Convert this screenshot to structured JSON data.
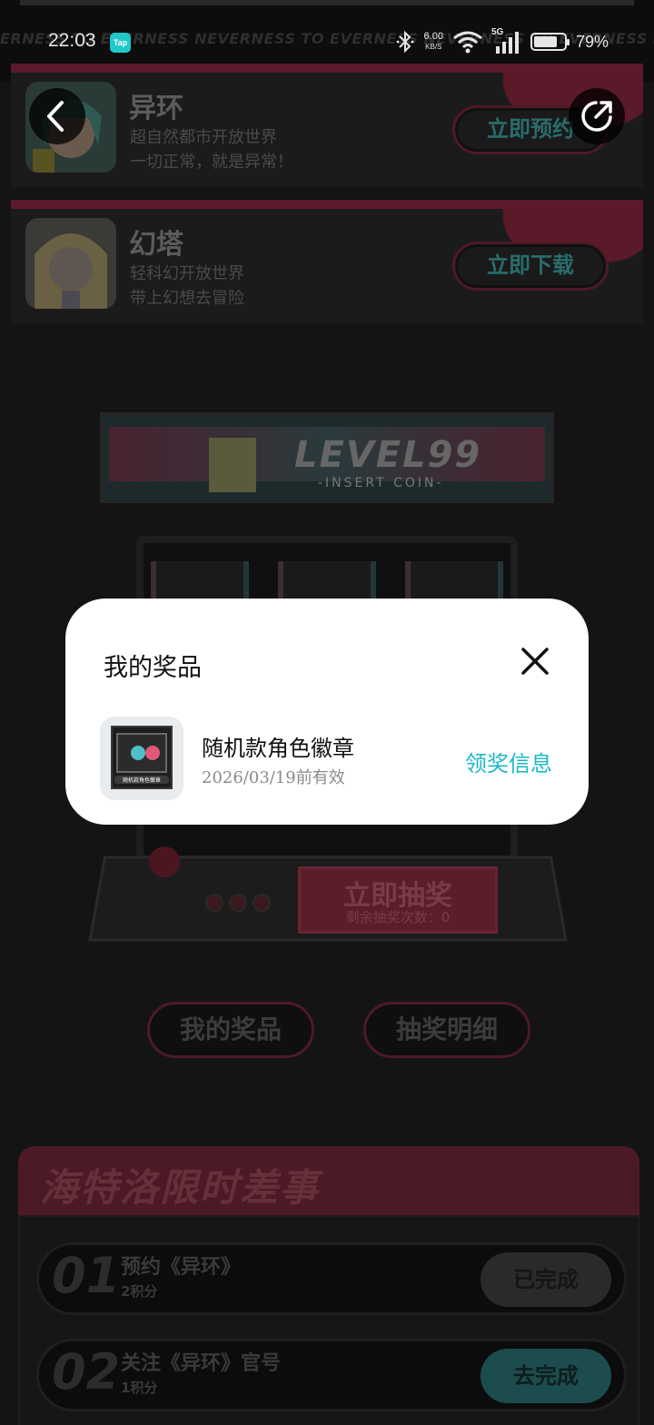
{
  "status_bar": {
    "time": "22:03",
    "app_badge": "Tap",
    "marquee_text": "ERNESS TO EVERNESS   NEVERNESS TO EVERNESS   NEVERNESS TO EVERNESS   NEVERNESS TO EVERNESS",
    "net_speed": "6.00",
    "net_unit": "KB/S",
    "network_type": "5G",
    "battery_percent": "79%",
    "battery_level": 0.79
  },
  "games": [
    {
      "title": "异环",
      "desc_line1": "超自然都市开放世界",
      "desc_line2": "一切正常，就是异常！",
      "cta": "立即预约"
    },
    {
      "title": "幻塔",
      "desc_line1": "轻科幻开放世界",
      "desc_line2": "带上幻想去冒险",
      "cta": "立即下载"
    }
  ],
  "arcade": {
    "marquee_title": "LEVEL99",
    "insert_coin": "-INSERT COIN-",
    "draw_button": "立即抽奖",
    "draw_count": "剩余抽奖次数：0"
  },
  "actions": {
    "my_prizes": "我的奖品",
    "draw_details": "抽奖明细"
  },
  "tasks": {
    "title": "海特洛限时差事",
    "items": [
      {
        "num": "01",
        "name": "预约《异环》",
        "points": "2积分",
        "button": "已完成",
        "done": true
      },
      {
        "num": "02",
        "name": "关注《异环》官号",
        "points": "1积分",
        "button": "去完成",
        "done": false
      }
    ]
  },
  "modal": {
    "title": "我的奖品",
    "prize": {
      "name": "随机款角色徽章",
      "validity": "2026/03/19前有效",
      "thumb_label": "随机款角色徽章",
      "link": "领奖信息"
    }
  },
  "colors": {
    "accent_cyan": "#19b9c7",
    "brand_red": "#5a1a2a",
    "modal_bg": "#ffffff"
  },
  "icons": [
    "back-arrow-icon",
    "share-icon",
    "close-icon",
    "bluetooth-icon",
    "wifi-icon",
    "signal-icon",
    "battery-icon"
  ]
}
